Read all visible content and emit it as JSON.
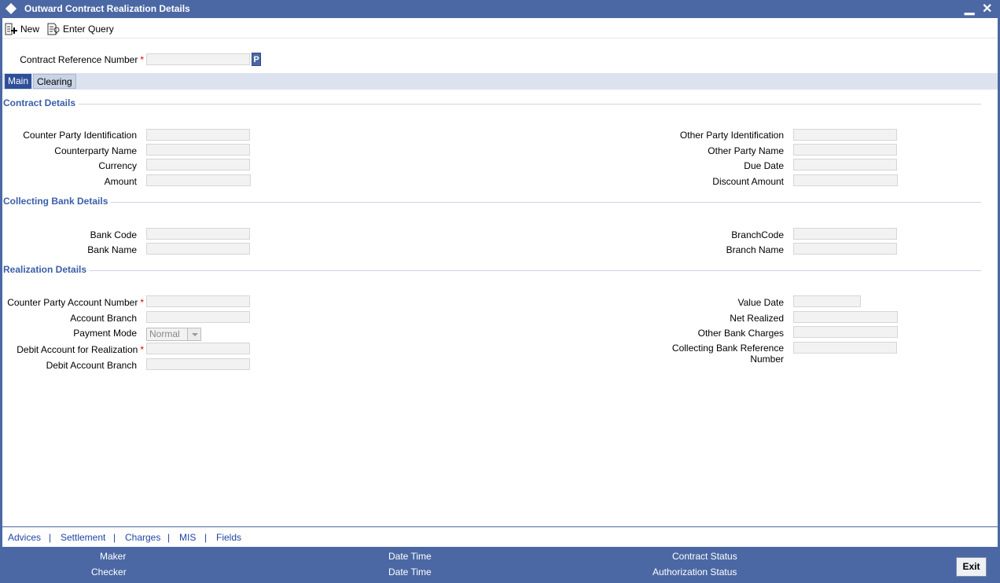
{
  "window": {
    "title": "Outward Contract Realization Details"
  },
  "toolbar": {
    "new_label": "New",
    "enter_query_label": "Enter Query"
  },
  "header": {
    "contract_ref_label": "Contract Reference Number",
    "contract_ref_value": "",
    "lookup_button": "P"
  },
  "tabs": [
    {
      "label": "Main",
      "active": true
    },
    {
      "label": "Clearing",
      "active": false
    }
  ],
  "contract_details": {
    "title": "Contract Details",
    "counter_party_identification": "Counter Party Identification",
    "counterparty_name": "Counterparty Name",
    "currency": "Currency",
    "amount": "Amount",
    "other_party_identification": "Other Party Identification",
    "other_party_name": "Other Party Name",
    "due_date": "Due Date",
    "discount_amount": "Discount Amount"
  },
  "collecting_bank_details": {
    "title": "Collecting Bank Details",
    "bank_code": "Bank Code",
    "bank_name": "Bank Name",
    "branch_code": "BranchCode",
    "branch_name": "Branch Name"
  },
  "realization_details": {
    "title": "Realization Details",
    "counter_party_account_number": "Counter Party Account Number",
    "account_branch": "Account Branch",
    "payment_mode": "Payment Mode",
    "payment_mode_value": "Normal",
    "debit_account_for_realization": "Debit Account for Realization",
    "debit_account_branch": "Debit Account Branch",
    "value_date": "Value Date",
    "net_realized": "Net Realized",
    "other_bank_charges": "Other Bank Charges",
    "collecting_bank_reference_line1": "Collecting Bank Reference",
    "collecting_bank_reference_line2": "Number"
  },
  "links": [
    "Advices",
    "Settlement",
    "Charges",
    "MIS",
    "Fields"
  ],
  "link_separator": "|",
  "status": {
    "maker": "Maker",
    "checker": "Checker",
    "date_time_1": "Date Time",
    "date_time_2": "Date Time",
    "contract_status": "Contract Status",
    "authorization_status": "Authorization Status",
    "exit_label": "Exit"
  },
  "required_marker": "*",
  "icons": {
    "diamond": "diamond-icon",
    "new": "new-document-icon",
    "enter_query": "query-icon",
    "minimize": "minimize-icon",
    "close": "close-icon"
  },
  "colors": {
    "titlebar": "#4b68a4",
    "section_title": "#3a5ea8",
    "required": "#dd0000",
    "link": "#1f45a3"
  }
}
